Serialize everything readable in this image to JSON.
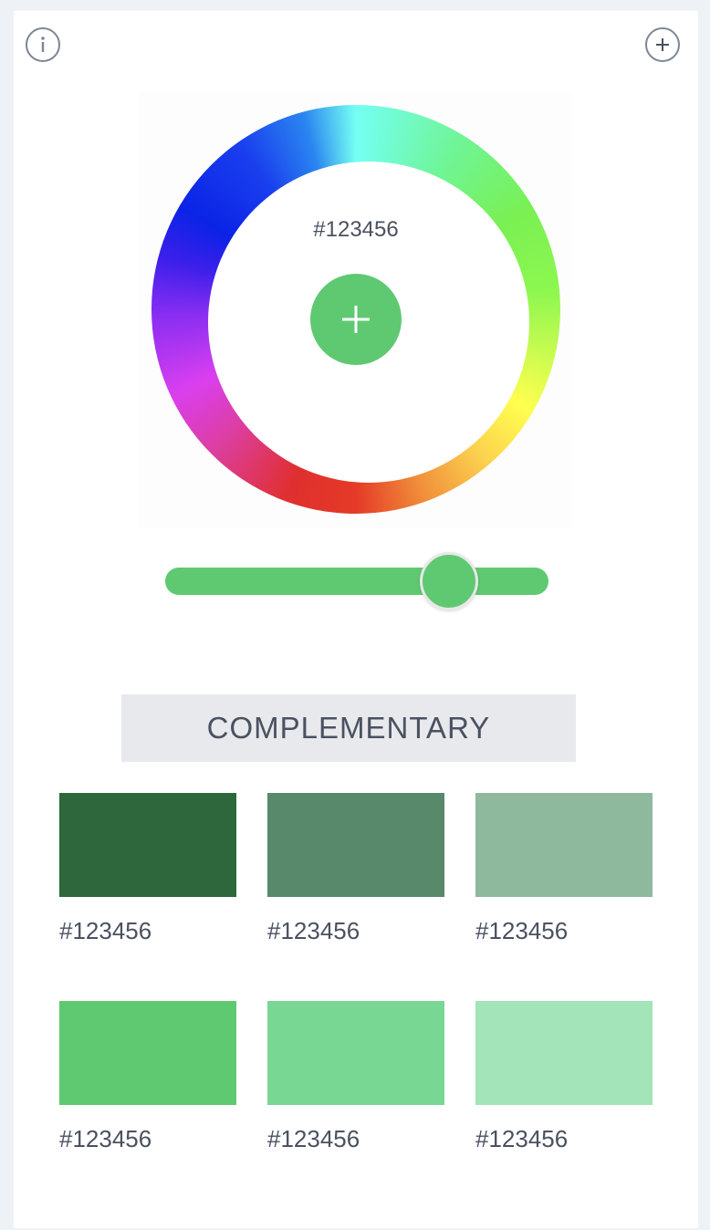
{
  "top_bar": {
    "info_icon": "info-icon",
    "add_icon": "plus-circle-icon"
  },
  "wheel": {
    "selected_hex": "#123456",
    "add_icon": "plus-icon"
  },
  "slider": {
    "value_fraction": 0.74,
    "color": "#5fc972"
  },
  "scheme": {
    "label": "COMPLEMENTARY"
  },
  "swatches": [
    {
      "color": "#2d673b",
      "label": "#123456"
    },
    {
      "color": "#57896a",
      "label": "#123456"
    },
    {
      "color": "#8fb99c",
      "label": "#123456"
    },
    {
      "color": "#5fc972",
      "label": "#123456"
    },
    {
      "color": "#79d794",
      "label": "#123456"
    },
    {
      "color": "#a3e4b9",
      "label": "#123456"
    }
  ],
  "colors": {
    "accent": "#5fc972",
    "text": "#4a5160",
    "background": "#eef1f6"
  }
}
